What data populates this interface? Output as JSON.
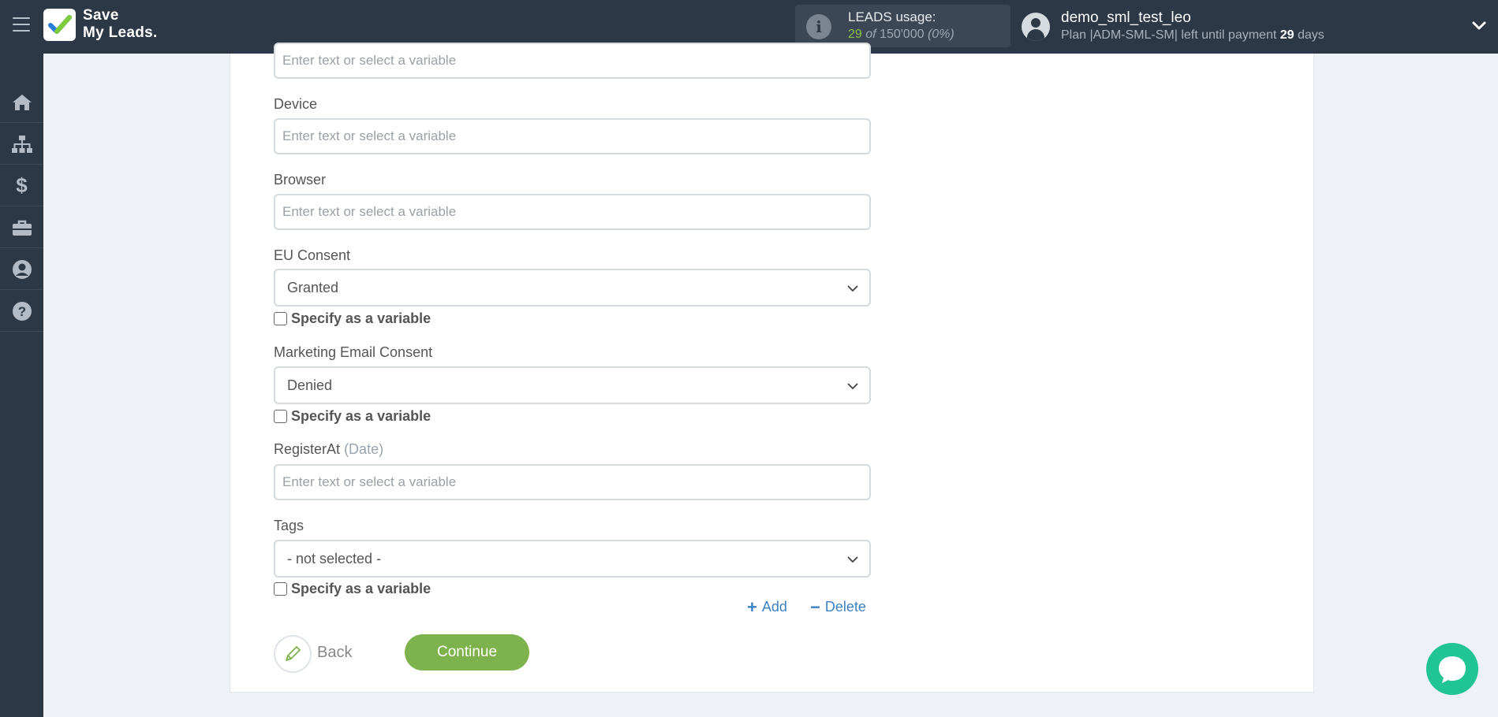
{
  "header": {
    "logo_line1": "Save",
    "logo_line2": "My Leads.",
    "usage_title": "LEADS usage:",
    "usage_used": "29",
    "usage_of": "of",
    "usage_total": "150'000",
    "usage_percent": "(0%)",
    "user_name": "demo_sml_test_leo",
    "plan_prefix": "Plan |ADM-SML-SM| left until payment",
    "plan_days": "29",
    "plan_suffix": "days"
  },
  "sidebar": {
    "items": [
      {
        "icon": "home-icon"
      },
      {
        "icon": "sitemap-icon"
      },
      {
        "icon": "dollar-icon"
      },
      {
        "icon": "briefcase-icon"
      },
      {
        "icon": "user-circle-icon"
      },
      {
        "icon": "help-circle-icon"
      }
    ]
  },
  "form": {
    "top_field_placeholder": "Enter text or select a variable",
    "device": {
      "label": "Device",
      "placeholder": "Enter text or select a variable"
    },
    "browser": {
      "label": "Browser",
      "placeholder": "Enter text or select a variable"
    },
    "eu_consent": {
      "label": "EU Consent",
      "value": "Granted",
      "checkbox": "Specify as a variable"
    },
    "marketing_consent": {
      "label": "Marketing Email Consent",
      "value": "Denied",
      "checkbox": "Specify as a variable"
    },
    "register_at": {
      "label": "RegisterAt",
      "hint": "(Date)",
      "placeholder": "Enter text or select a variable"
    },
    "tags": {
      "label": "Tags",
      "value": "- not selected -",
      "checkbox": "Specify as a variable"
    },
    "add_label": "Add",
    "delete_label": "Delete"
  },
  "actions": {
    "back_label": "Back",
    "continue_label": "Continue"
  },
  "colors": {
    "topbar": "#2d3846",
    "accent_green": "#7eb24c",
    "link_blue": "#3d82c4",
    "chat": "#21c495"
  }
}
